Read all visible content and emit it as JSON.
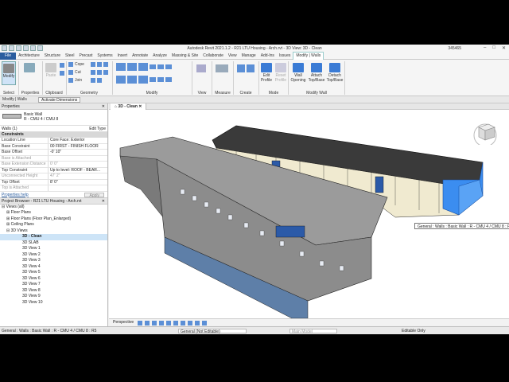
{
  "window": {
    "title": "Autodesk Revit 2021.1.2 - R21 LTU Housing - Arch.rvt - 3D View: 3D - Clean",
    "user": "345465"
  },
  "ribbon_tabs": [
    "File",
    "Architecture",
    "Structure",
    "Steel",
    "Precast",
    "Systems",
    "Insert",
    "Annotate",
    "Analyze",
    "Massing & Site",
    "Collaborate",
    "View",
    "Manage",
    "Add-Ins",
    "Issues",
    "Modify | Walls"
  ],
  "ribbon": {
    "modify": "Modify",
    "select": "Select",
    "properties": "Properties",
    "clipboard": "Clipboard",
    "paste": "Paste",
    "cope": "Cope",
    "cut": "Cut",
    "join": "Join",
    "geometry": "Geometry",
    "modify_group": "Modify",
    "view": "View",
    "measure": "Measure",
    "create": "Create",
    "edit_profile": "Edit Profile",
    "reset_profile": "Reset Profile",
    "mode": "Mode",
    "wall_opening": "Wall Opening",
    "attach": "Attach Top/Base",
    "detach": "Detach Top/Base",
    "modify_wall": "Modify Wall"
  },
  "context_bar": {
    "label": "Modify | Walls",
    "button": "Activate Dimensions"
  },
  "properties": {
    "header": "Properties",
    "type_family": "Basic Wall",
    "type_name": "R - CMU 4 / CMU 8",
    "instance": "Walls (1)",
    "edit_type": "Edit Type",
    "group": "Constraints",
    "rows": [
      {
        "k": "Location Line",
        "v": "Core Face: Exterior"
      },
      {
        "k": "Base Constraint",
        "v": "00 FIRST - FINISH FLOOR"
      },
      {
        "k": "Base Offset",
        "v": "-0' 10\""
      },
      {
        "k": "Base is Attached",
        "v": ""
      },
      {
        "k": "Base Extension Distance",
        "v": "0' 0\""
      },
      {
        "k": "Top Constraint",
        "v": "Up to level: ROOF - BEAR..."
      },
      {
        "k": "Unconnected Height",
        "v": "47' 2\""
      },
      {
        "k": "Top Offset",
        "v": "8' 0\""
      },
      {
        "k": "Top is Attached",
        "v": ""
      }
    ],
    "help": "Properties help",
    "apply": "Apply"
  },
  "browser": {
    "header": "Project Browser - R21 LTU Housing - Arch.rvt",
    "items": [
      "Views (all)",
      "Floor Plans",
      "Floor Plans (Floor Plan_Enlarged)",
      "Ceiling Plans",
      "3D Views",
      "3D - Clean",
      "3D SLAB",
      "3D View 1",
      "3D View 2",
      "3D View 3",
      "3D View 4",
      "3D View 5",
      "3D View 6",
      "3D View 7",
      "3D View 8",
      "3D View 9",
      "3D View 10"
    ]
  },
  "view_tab": "3D - Clean",
  "tooltip": "General : Walls : Basic Wall : R - CMU 4 / CMU 8 : R5",
  "view_control": {
    "mode": "Perspective"
  },
  "status": {
    "left": "General : Walls : Basic Wall : R - CMU 4 / CMU 8 : R5",
    "workset": "General (Not Editable)",
    "model": "Main Model",
    "editable": "Editable Only"
  },
  "colors": {
    "file_tab": "#2a5d9f",
    "selection_blue": "#3b8df0"
  }
}
